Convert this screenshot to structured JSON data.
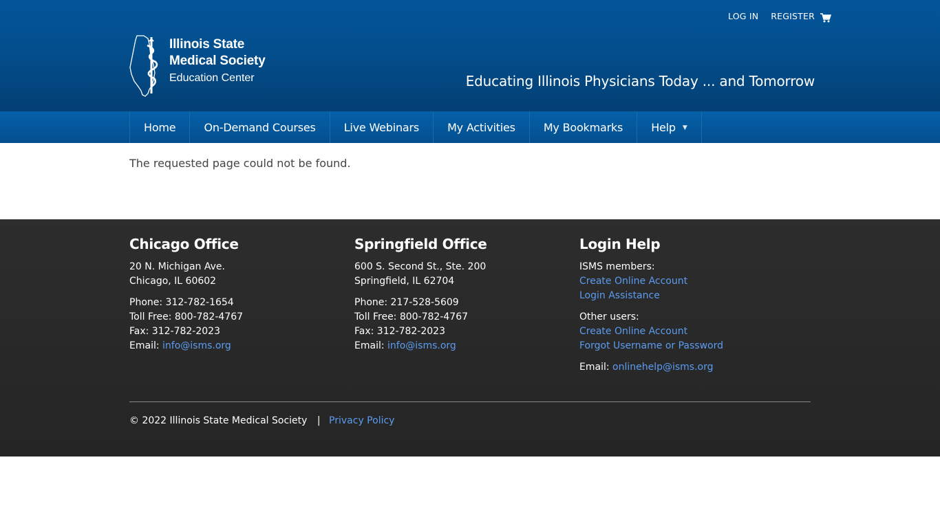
{
  "header": {
    "login": "LOG IN",
    "register": "REGISTER",
    "cart_icon": "shopping-cart-icon",
    "logo": {
      "line1": "Illinois State",
      "line2": "Medical Society",
      "line3": "Education Center"
    },
    "tagline": "Educating Illinois Physicians Today ... and Tomorrow"
  },
  "nav": {
    "items": [
      {
        "label": "Home"
      },
      {
        "label": "On-Demand Courses"
      },
      {
        "label": "Live Webinars"
      },
      {
        "label": "My Activities"
      },
      {
        "label": "My Bookmarks"
      },
      {
        "label": "Help"
      }
    ]
  },
  "main": {
    "message": "The requested page could not be found."
  },
  "footer": {
    "chicago": {
      "title": "Chicago Office",
      "addr1": "20 N. Michigan Ave.",
      "addr2": "Chicago, IL 60602",
      "phone": "Phone: 312-782-1654",
      "tollfree": "Toll Free: 800-782-4767",
      "fax": "Fax: 312-782-2023",
      "email_label": "Email:",
      "email": "info@isms.org"
    },
    "springfield": {
      "title": "Springfield Office",
      "addr1": "600 S. Second St., Ste. 200",
      "addr2": "Springfield, IL 62704",
      "phone": "Phone: 217-528-5609",
      "tollfree": "Toll Free: 800-782-4767",
      "fax": "Fax: 312-782-2023",
      "email_label": "Email:",
      "email": "info@isms.org"
    },
    "login_help": {
      "title": "Login Help",
      "members_label": "ISMS members:",
      "members_create": "Create Online Account",
      "members_assist": "Login Assistance",
      "others_label": "Other users:",
      "others_create": "Create Online Account",
      "others_forgot": "Forgot Username or Password",
      "email_label": "Email:",
      "email": "onlinehelp@isms.org"
    },
    "copyright": "© 2022 Illinois State Medical Society",
    "separator": "|",
    "privacy": "Privacy Policy"
  },
  "colors": {
    "header_blue": "#03549a",
    "nav_blue": "#0560a8",
    "footer_bg": "#2b2b2b",
    "link": "#5b9cf0"
  }
}
